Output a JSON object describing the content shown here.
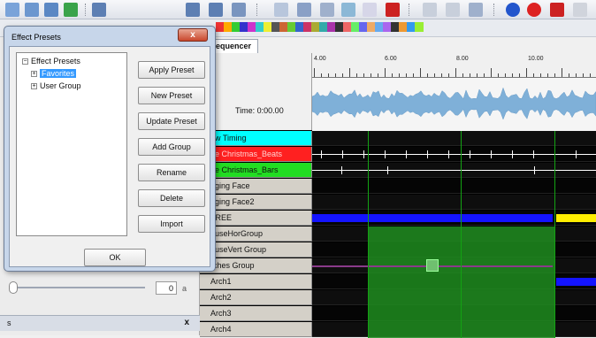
{
  "dialog": {
    "title": "Effect Presets",
    "close_label": "x",
    "tree": {
      "root": "Effect Presets",
      "children": [
        "Favorites",
        "User Group"
      ]
    },
    "buttons": [
      "Apply Preset",
      "New Preset",
      "Update Preset",
      "Add Group",
      "Rename",
      "Delete",
      "Import"
    ],
    "ok_label": "OK"
  },
  "sequencer": {
    "tab_label": "equencer",
    "time_label": "Time: 0:00.00",
    "ruler_labels": [
      "4.00",
      "6.00",
      "8.00",
      "10.00"
    ],
    "rows": [
      {
        "label": "ew Timing",
        "color": "#00ffff",
        "text_color": "#111111"
      },
      {
        "label": "ue Christmas_Beats",
        "color": "#ff2020",
        "text_color": "#ffd0d0"
      },
      {
        "label": "ue Christmas_Bars",
        "color": "#22dd22",
        "text_color": "#111111"
      },
      {
        "label": "nging Face",
        "color": "#d4d0c8",
        "text_color": "#111111"
      },
      {
        "label": "nging Face2",
        "color": "#d4d0c8",
        "text_color": "#111111"
      },
      {
        "label": "TREE",
        "color": "#d4d0c8",
        "text_color": "#111111"
      },
      {
        "label": "ouseHorGroup",
        "color": "#d4d0c8",
        "text_color": "#111111"
      },
      {
        "label": "ouseVert Group",
        "color": "#d4d0c8",
        "text_color": "#111111"
      },
      {
        "label": "rches Group",
        "color": "#d4d0c8",
        "text_color": "#111111"
      },
      {
        "label": "Arch1",
        "color": "#d4d0c8",
        "text_color": "#111111"
      },
      {
        "label": "Arch2",
        "color": "#d4d0c8",
        "text_color": "#111111"
      },
      {
        "label": "Arch3",
        "color": "#d4d0c8",
        "text_color": "#111111"
      },
      {
        "label": "Arch4",
        "color": "#d4d0c8",
        "text_color": "#111111"
      }
    ]
  },
  "left_panel": {
    "value_field": "0",
    "bottom_label": "s",
    "bottom_close": "x"
  },
  "colors": {
    "accent_blue": "#1414ff",
    "accent_yellow": "#ffee00",
    "green_effect": "#1e8c1e"
  }
}
